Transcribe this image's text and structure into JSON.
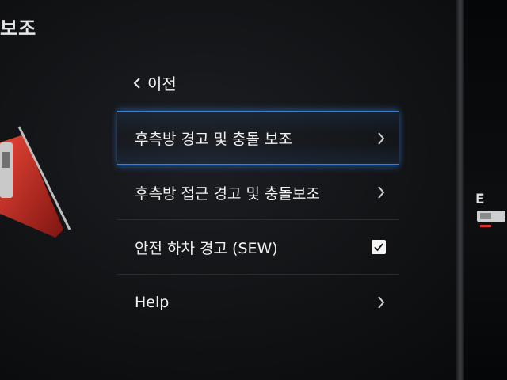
{
  "corner_title": "보조",
  "right_letter": "E",
  "back": {
    "label": "이전"
  },
  "menu": {
    "items": [
      {
        "label": "후측방 경고 및 충돌 보조",
        "control": "chevron",
        "selected": true
      },
      {
        "label": "후측방 접근 경고 및 충돌보조",
        "control": "chevron",
        "selected": false
      },
      {
        "label": "안전 하차 경고 (SEW)",
        "control": "checkbox",
        "checked": true
      },
      {
        "label": "Help",
        "control": "chevron",
        "selected": false
      }
    ]
  },
  "colors": {
    "highlight": "#3a7fd0",
    "text": "#f2f2f2",
    "accent_red": "#d8332a"
  }
}
